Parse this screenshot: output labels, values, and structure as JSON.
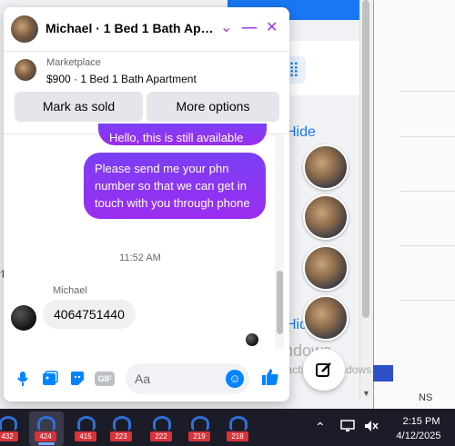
{
  "background": {
    "hide_label_top": "Hide",
    "hide_label_bottom": "Hide",
    "grid_icon": "grid-icon",
    "right_window_text": "NS",
    "watermark": {
      "title": "Activate Windows",
      "subtitle": "Go to Settings to activate Windows."
    },
    "compose_icon": "compose-icon"
  },
  "chat": {
    "header": {
      "title": "Michael · 1 Bed 1 Bath Apa...",
      "chevron_icon": "⌄",
      "minimize_icon": "—",
      "close_icon": "✕"
    },
    "marketplace": {
      "label": "Marketplace",
      "listing": "$900 · 1 Bed 1 Bath Apartment",
      "mark_sold_label": "Mark as sold",
      "more_options_label": "More options"
    },
    "messages": {
      "partial_outgoing": "Hello, this is still available",
      "outgoing": "Please send me your phn number so that we can get in touch with you through phone",
      "timestamp": "11:52 AM",
      "sender_name": "Michael",
      "incoming": "4064751440"
    },
    "composer": {
      "placeholder": "Aa",
      "gif_label": "GIF",
      "icons": [
        "microphone-icon",
        "photo-icon",
        "sticker-icon",
        "gif-icon",
        "emoji-icon",
        "like-icon"
      ]
    }
  },
  "taskbar": {
    "badges": [
      "432",
      "424",
      "415",
      "223",
      "222",
      "219",
      "218"
    ],
    "clock_time": "2:15 PM",
    "clock_date": "4/12/2025",
    "tray_icons": [
      "chevron-up-icon",
      "display-icon",
      "speaker-muted-icon"
    ]
  }
}
